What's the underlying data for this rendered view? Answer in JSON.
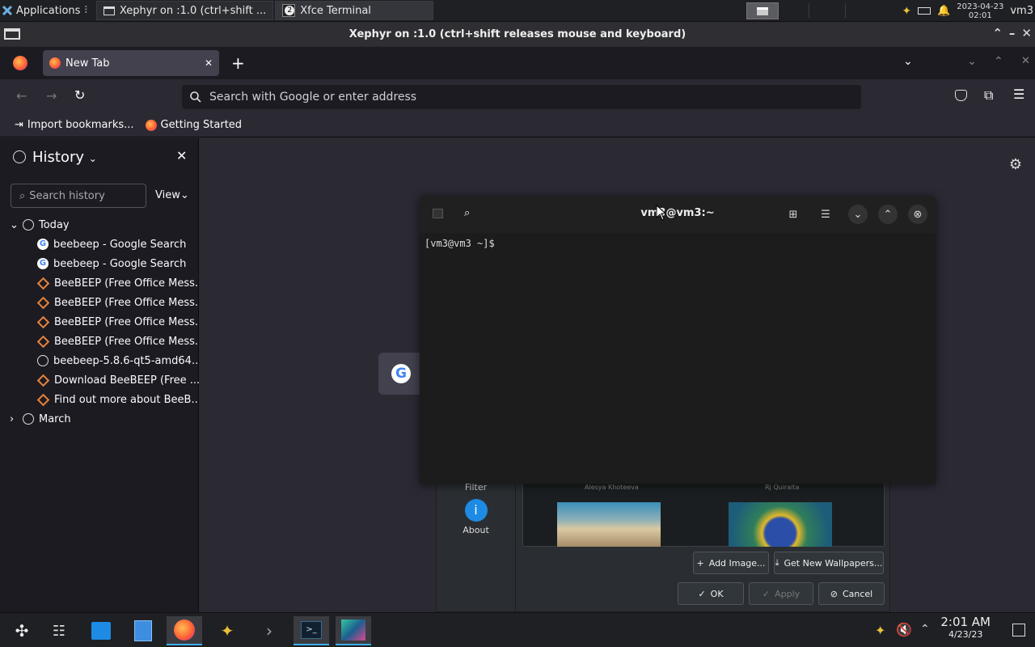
{
  "top_panel": {
    "applications_label": "Applications",
    "task_xephyr": "Xephyr on :1.0 (ctrl+shift ...",
    "task_terminal": "Xfce Terminal",
    "task_terminal_count": "2",
    "clock_date": "2023-04-23",
    "clock_time": "02:01",
    "user": "vm3"
  },
  "xephyr": {
    "title": "Xephyr on :1.0 (ctrl+shift releases mouse and keyboard)"
  },
  "firefox": {
    "tab_label": "New Tab",
    "url_placeholder": "Search with Google or enter address",
    "bookmarks": [
      "Import bookmarks...",
      "Getting Started"
    ],
    "sidebar": {
      "title": "History",
      "search_placeholder": "Search history",
      "view_label": "View",
      "groups": [
        {
          "label": "Today",
          "items": [
            {
              "label": "beebeep - Google Search",
              "icon": "google-icon"
            },
            {
              "label": "beebeep - Google Search",
              "icon": "google-icon"
            },
            {
              "label": "BeeBEEP (Free Office Mess...",
              "icon": "beebeep-icon"
            },
            {
              "label": "BeeBEEP (Free Office Mess...",
              "icon": "beebeep-icon"
            },
            {
              "label": "BeeBEEP (Free Office Mess...",
              "icon": "beebeep-icon"
            },
            {
              "label": "BeeBEEP (Free Office Mess...",
              "icon": "beebeep-icon"
            },
            {
              "label": "beebeep-5.8.6-qt5-amd64....",
              "icon": "globe-icon"
            },
            {
              "label": "Download BeeBEEP (Free ...",
              "icon": "beebeep-icon"
            },
            {
              "label": "Find out more about BeeB...",
              "icon": "beebeep-icon"
            }
          ]
        },
        {
          "label": "March",
          "items": []
        }
      ]
    }
  },
  "wallpaper_dialog": {
    "filter_label": "Filter",
    "about_label": "About",
    "credit_left": "Alesya Khoteeva",
    "credit_right": "Rj Quiralta",
    "add_image": "Add Image...",
    "get_new": "Get New Wallpapers...",
    "ok": "OK",
    "apply": "Apply",
    "cancel": "Cancel"
  },
  "terminal": {
    "title": "vm3@vm3:~",
    "prompt": "[vm3@vm3 ~]$"
  },
  "bottom_panel": {
    "time": "2:01 AM",
    "date": "4/23/23"
  },
  "colors": {
    "accent": "#3daee9",
    "firefox_toolbar": "#2b2a33",
    "firefox_tabbar": "#1c1b22",
    "beebeep_orange": "#e8833a"
  }
}
